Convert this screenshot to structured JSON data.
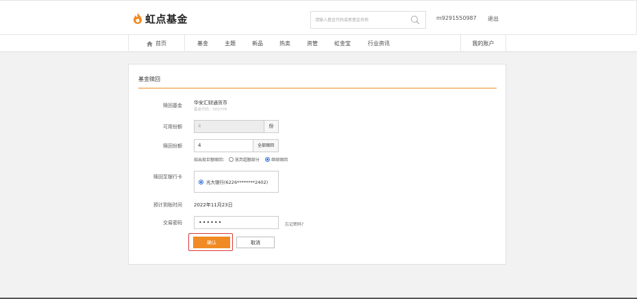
{
  "header": {
    "logo_text": "虹点基金",
    "search_placeholder": "请输入基金代码或者基金名称",
    "user_id": "m9291550987",
    "logout_label": "退出"
  },
  "nav": {
    "home_label": "首页",
    "items": [
      "基金",
      "主题",
      "新品",
      "热卖",
      "资管",
      "虹金宝",
      "行业资讯"
    ],
    "account_label": "我的账户"
  },
  "form": {
    "title": "基金赎回",
    "fund_label": "赎回基金",
    "fund_name": "华安汇财通货币",
    "fund_code": "基金代码：000709",
    "available_label": "可用份额",
    "available_value": "4",
    "available_unit": "份",
    "redeem_label": "赎回份额",
    "redeem_value": "4",
    "redeem_all_label": "全部赎回",
    "huge_redeem_prompt": "如出现巨额赎回：",
    "option_abandon": "放弃超额部分",
    "option_continue": "继续赎回",
    "bank_label": "赎回至银行卡",
    "bank_value": "光大银行(6226********2402)",
    "arrival_label": "预计到账时间",
    "arrival_value": "2022年11月23日",
    "password_label": "交易密码",
    "password_value": "••••••",
    "forgot_label": "忘记密码?",
    "confirm_label": "确认",
    "cancel_label": "取消"
  },
  "colors": {
    "accent": "#f08a24",
    "highlight": "#dd3333",
    "radio_selected": "#2a6fdb"
  }
}
